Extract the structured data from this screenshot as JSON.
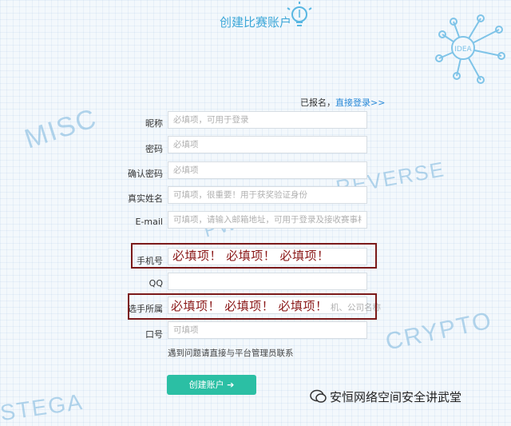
{
  "page": {
    "title": "创建比赛账户",
    "deco_words": [
      "MISC",
      "REVERSE",
      "PWN",
      "CRYPTO",
      "STEGA"
    ],
    "idea_badge": "IDEA"
  },
  "registered": {
    "text": "已报名，",
    "link": "直接登录>>"
  },
  "form": {
    "fields": [
      {
        "label": "昵称",
        "placeholder": "必填项，可用于登录",
        "value": ""
      },
      {
        "label": "密码",
        "placeholder": "必填项",
        "value": ""
      },
      {
        "label": "确认密码",
        "placeholder": "必填项",
        "value": ""
      },
      {
        "label": "真实姓名",
        "placeholder": "可填项，很重要！用于获奖验证身份",
        "value": ""
      },
      {
        "label": "E-mail",
        "placeholder": "可填项，请输入邮箱地址，可用于登录及接收赛事相关信息",
        "value": ""
      },
      {
        "label": "手机号",
        "placeholder": "",
        "value": ""
      },
      {
        "label": "QQ",
        "placeholder": "",
        "value": ""
      },
      {
        "label": "选手所属",
        "placeholder": "",
        "value": ""
      },
      {
        "label": "口号",
        "placeholder": "可填项",
        "value": ""
      }
    ],
    "help_text": "遇到问题请直接与平台管理员联系",
    "submit_label": "创建账户 ➔",
    "affiliation_tail": "机、公司名称"
  },
  "annotations": {
    "phone_note": "必填项！ 必填项！ 必填项！",
    "affiliation_note": "必填项！ 必填项！ 必填项！"
  },
  "watermark": {
    "text": "安恒网络空间安全讲武堂"
  },
  "colors": {
    "accent": "#3da7d8",
    "button": "#2bbfa4",
    "annotation": "#7b1a1a"
  }
}
